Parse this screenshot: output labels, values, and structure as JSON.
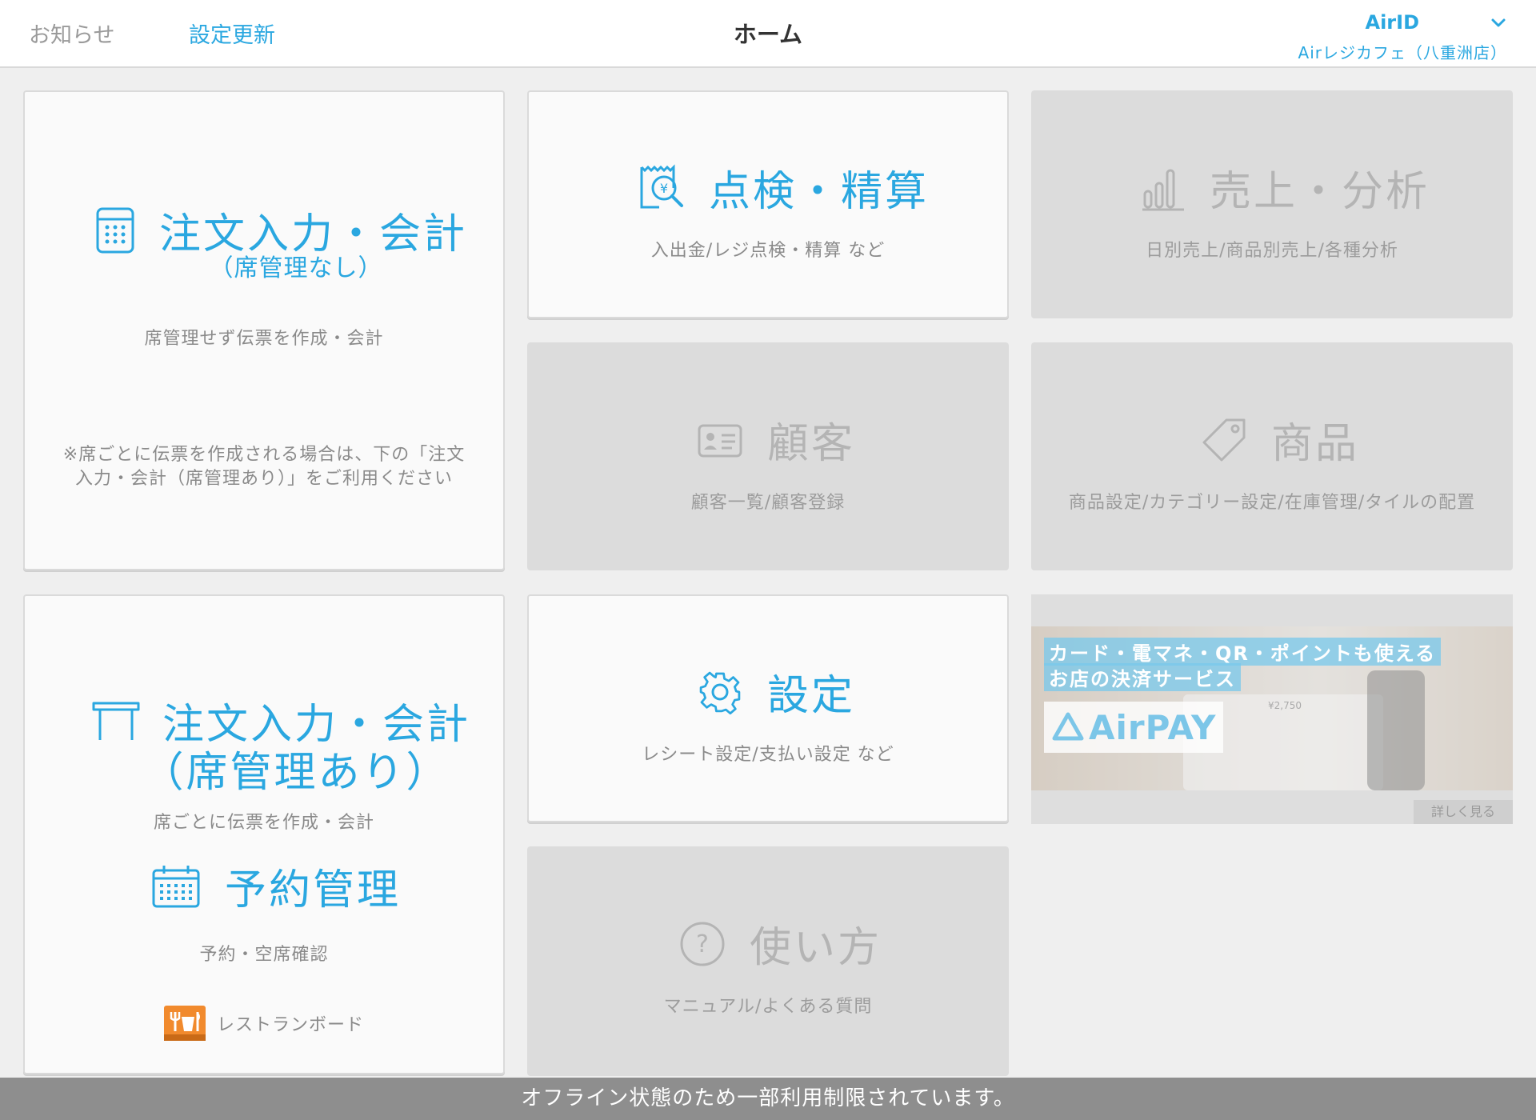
{
  "header": {
    "notice_label": "お知らせ",
    "settings_update_label": "設定更新",
    "title": "ホーム",
    "account_id": "AirID",
    "store_name": "Airレジカフェ（八重洲店）"
  },
  "tiles": {
    "order_no_seat": {
      "title": "注文入力・会計",
      "subtitle": "（席管理なし）",
      "desc": "席管理せず伝票を作成・会計",
      "note_line1": "※席ごとに伝票を作成される場合は、下の「注文",
      "note_line2": "入力・会計（席管理あり）」をご利用ください"
    },
    "inspection": {
      "title": "点検・精算",
      "desc": "入出金/レジ点検・精算 など"
    },
    "sales": {
      "title": "売上・分析",
      "desc": "日別売上/商品別売上/各種分析"
    },
    "customer": {
      "title": "顧客",
      "desc": "顧客一覧/顧客登録"
    },
    "products": {
      "title": "商品",
      "desc": "商品設定/カテゴリー設定/在庫管理/タイルの配置"
    },
    "order_seat": {
      "title_line1": "注文入力・会計",
      "title_line2": "（席管理あり）",
      "desc": "席ごとに伝票を作成・会計",
      "reservation_title": "予約管理",
      "reservation_desc": "予約・空席確認",
      "board_label": "レストランボード"
    },
    "settings": {
      "title": "設定",
      "desc": "レシート設定/支払い設定 など"
    },
    "howto": {
      "title": "使い方",
      "desc": "マニュアル/よくある質問"
    }
  },
  "banner": {
    "line1": "カード・電マネ・QR・ポイントも使える",
    "line2": "お店の決済サービス",
    "logo_text": "AirPAY",
    "price": "¥2,750",
    "more_label": "詳しく見る"
  },
  "offline_message": "オフライン状態のため一部利用制限されています。",
  "colors": {
    "accent": "#2aa7e0",
    "disabled_tile": "#dcdcdc",
    "offline_bar": "#8e8e8e",
    "board_orange": "#f18a2d"
  }
}
